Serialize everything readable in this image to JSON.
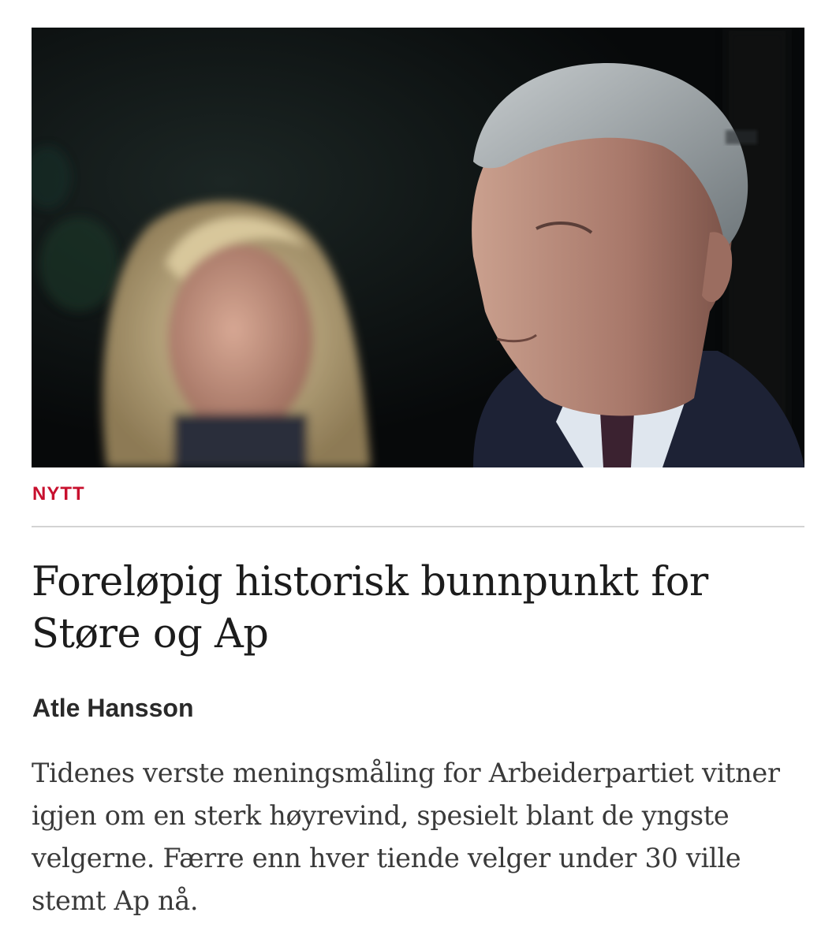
{
  "article": {
    "image": {
      "subject": "photo-man-and-woman",
      "colors": {
        "background": "#0b0d0f",
        "hair_gray": "#9aa0a4",
        "hair_blonde": "#c9b890",
        "skin": "#b98c78",
        "suit": "#1d2235"
      }
    },
    "section_label": "NYTT",
    "section_color": "#c8102e",
    "headline": "Foreløpig historisk bunnpunkt for Støre og Ap",
    "author": "Atle Hansson",
    "lede": "Tidenes verste meningsmåling for Arbeiderpartiet vitner igjen om en sterk høyrevind, spesielt blant de yngste velgerne. Færre enn hver tiende velger under 30 ville stemt Ap nå."
  }
}
